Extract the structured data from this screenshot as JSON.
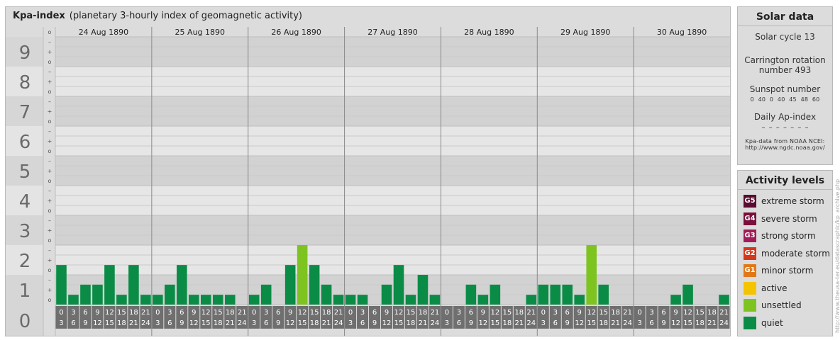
{
  "main": {
    "title": "Kpa-index",
    "subtitle": "(planetary 3-hourly index of geomagnetic activity)"
  },
  "solar": {
    "title": "Solar data",
    "cycle": "Solar cycle 13",
    "carrington_line1": "Carrington rotation",
    "carrington_line2": "number 493",
    "sunspot_label": "Sunspot number",
    "sunspot_values": "0   40   0   40  45  48  60",
    "ap_label": "Daily Ap-index",
    "ap_values": "–  –  –  –  –  –  –",
    "source_line1": "Kpa-data from NOAA NCEI:",
    "source_line2": "http://www.ngdc.noaa.gov/"
  },
  "activity": {
    "title": "Activity levels",
    "levels": [
      {
        "badge": "G5",
        "label": "extreme storm",
        "color": "#5a0a2e"
      },
      {
        "badge": "G4",
        "label": "severe storm",
        "color": "#7a0e3c"
      },
      {
        "badge": "G3",
        "label": "strong storm",
        "color": "#a01c58"
      },
      {
        "badge": "G2",
        "label": "moderate storm",
        "color": "#d2381c"
      },
      {
        "badge": "G1",
        "label": "minor storm",
        "color": "#e17818"
      },
      {
        "badge": "",
        "label": "active",
        "color": "#f5c400"
      },
      {
        "badge": "",
        "label": "unsettled",
        "color": "#7ec421"
      },
      {
        "badge": "",
        "label": "quiet",
        "color": "#0a8c46"
      }
    ]
  },
  "credit": "http://www.theusa-ter.eu/datascraphic/kp_archive.php",
  "chart_data": {
    "type": "bar",
    "title": "Kpa-index",
    "ylim": [
      0,
      9
    ],
    "y_ticks": [
      "0",
      "1",
      "2",
      "3",
      "4",
      "5",
      "6",
      "7",
      "8",
      "9"
    ],
    "minor_tick_labels": [
      "o",
      "+",
      "–"
    ],
    "days": [
      "24 Aug 1890",
      "25 Aug 1890",
      "26 Aug 1890",
      "27 Aug 1890",
      "28 Aug 1890",
      "29 Aug 1890",
      "30 Aug 1890"
    ],
    "interval_top": [
      "0",
      "3",
      "6",
      "9",
      "12",
      "15",
      "18",
      "21"
    ],
    "interval_bottom": [
      "3",
      "6",
      "9",
      "12",
      "15",
      "18",
      "21",
      "24"
    ],
    "values": [
      [
        1.33,
        0.33,
        0.67,
        0.67,
        1.33,
        0.33,
        1.33,
        0.33
      ],
      [
        0.33,
        0.67,
        1.33,
        0.33,
        0.33,
        0.33,
        0.33,
        0
      ],
      [
        0.33,
        0.67,
        0,
        1.33,
        2,
        1.33,
        0.67,
        0.33
      ],
      [
        0.33,
        0.33,
        0,
        0.67,
        1.33,
        0.33,
        1,
        0.33
      ],
      [
        0,
        0,
        0.67,
        0.33,
        0.67,
        0,
        0,
        0.33
      ],
      [
        0.67,
        0.67,
        0.67,
        0.33,
        2,
        0.67,
        0,
        0
      ],
      [
        0,
        0,
        0,
        0.33,
        0.67,
        0,
        0,
        0.33
      ]
    ],
    "colors": {
      "quiet": "#0a8c46",
      "unsettled": "#7ec421"
    }
  }
}
